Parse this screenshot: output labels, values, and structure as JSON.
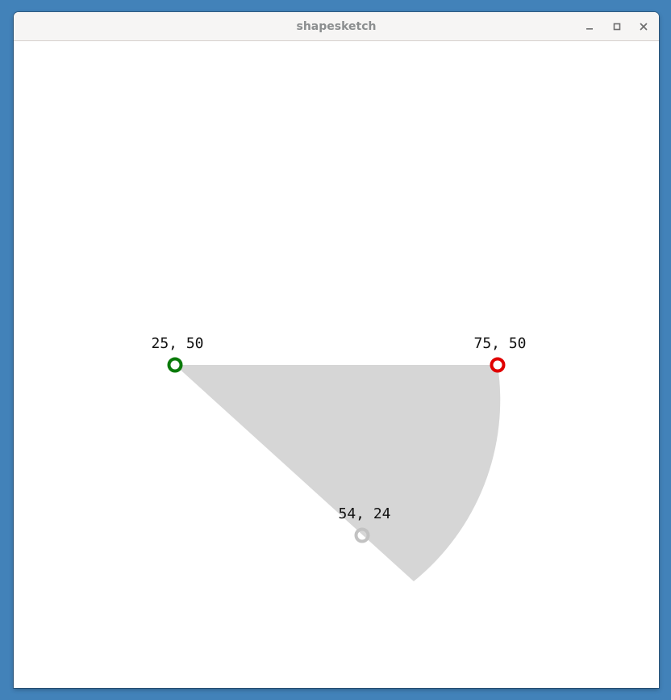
{
  "window": {
    "title": "shapesketch",
    "controls": [
      "minimize-icon",
      "maximize-icon",
      "close-icon"
    ]
  },
  "sketch": {
    "shape": "circular-sector",
    "fill_color": "#d6d6d6",
    "points": [
      {
        "role": "start",
        "label": "25, 50",
        "color": "#0a7a0a"
      },
      {
        "role": "end",
        "label": "75, 50",
        "color": "#e00000"
      },
      {
        "role": "center",
        "label": "54, 24",
        "color": "#c2c2c2"
      }
    ]
  }
}
